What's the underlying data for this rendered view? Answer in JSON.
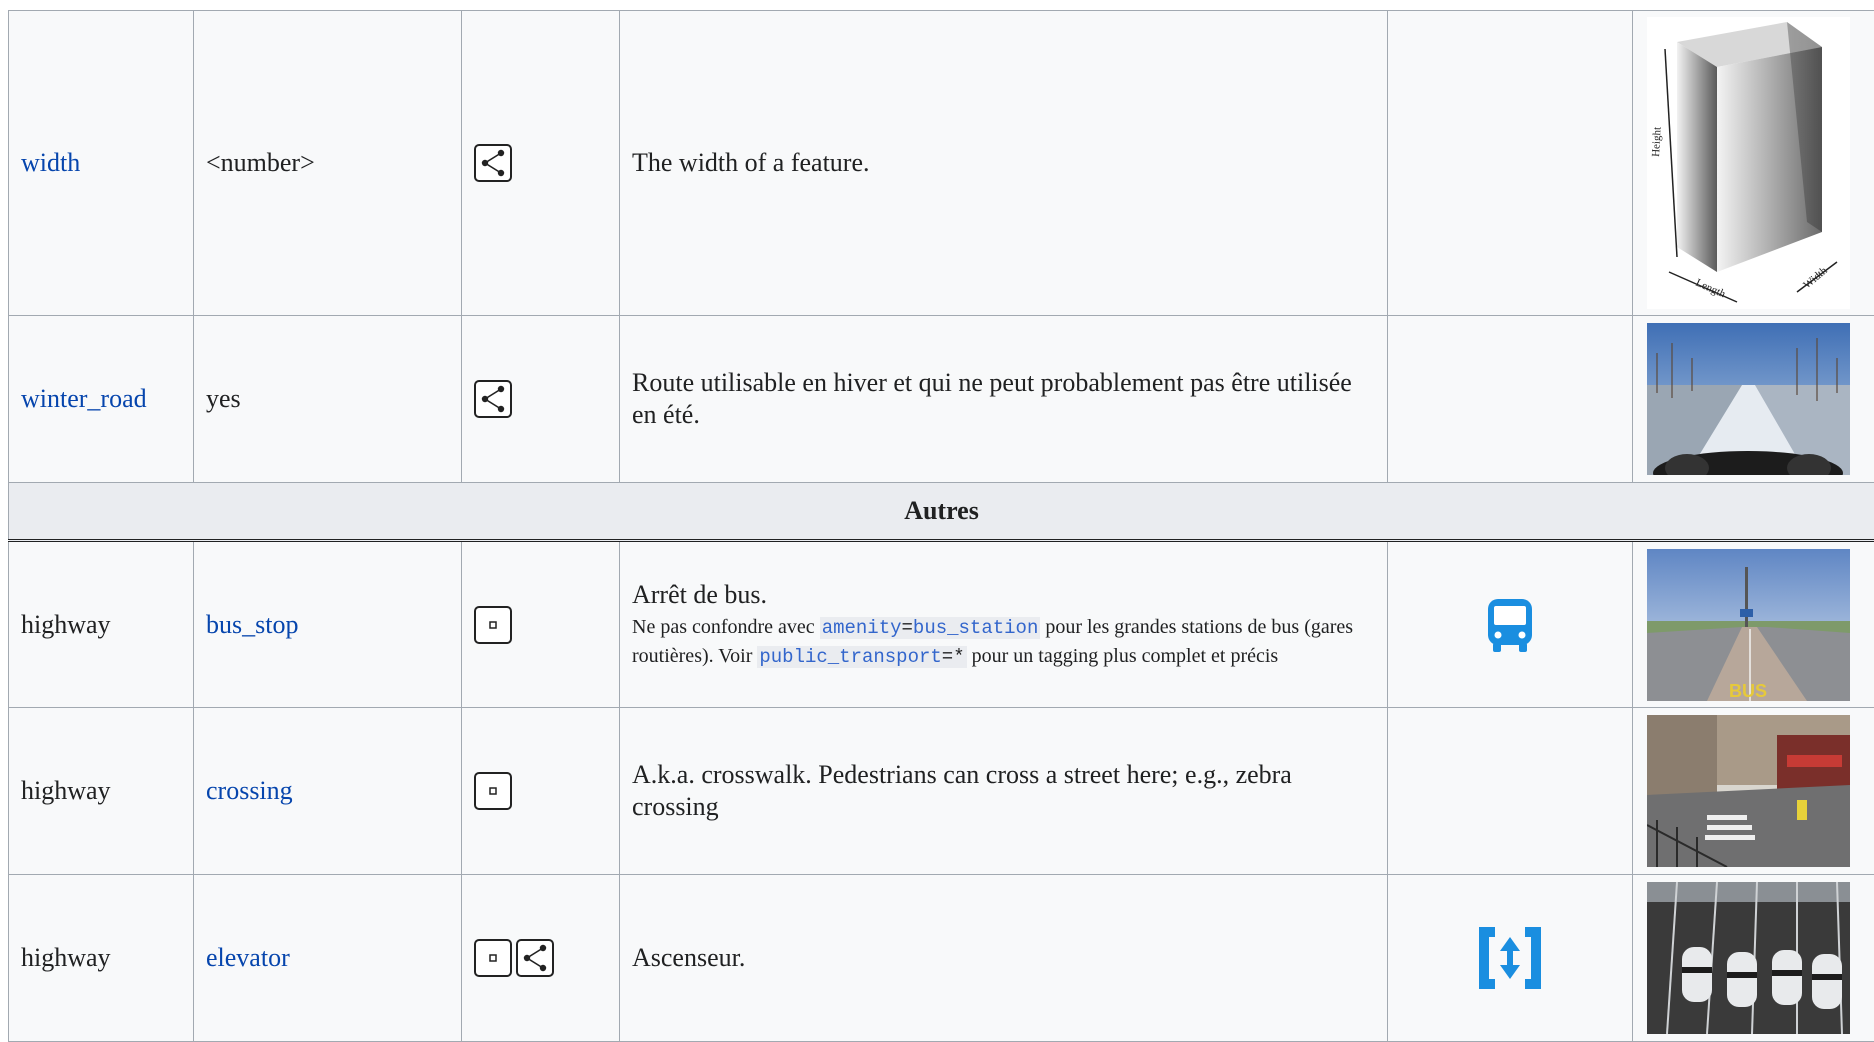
{
  "rows_top": [
    {
      "key": "width",
      "value": "<number>",
      "desc": "The width of a feature."
    },
    {
      "key": "winter_road",
      "value": "yes",
      "desc": "Route utilisable en hiver et qui ne peut probablement pas être utilisée en été."
    }
  ],
  "section": {
    "title": "Autres"
  },
  "rows_bottom": [
    {
      "key": "highway",
      "value": "bus_stop",
      "desc": "Arrêt de bus.",
      "note": {
        "prefix": "Ne pas confondre avec ",
        "tag1_key": "amenity",
        "tag1_eq": "=",
        "tag1_val": "bus_station",
        "middle": " pour les grandes stations de bus (gares routières). Voir ",
        "tag2_key": "public_transport",
        "tag2_eq": "=*",
        "suffix": " pour un tagging plus complet et précis"
      }
    },
    {
      "key": "highway",
      "value": "crossing",
      "desc": "A.k.a. crosswalk. Pedestrians can cross a street here; e.g., zebra crossing"
    },
    {
      "key": "highway",
      "value": "elevator",
      "desc": "Ascenseur."
    }
  ],
  "image_labels": {
    "height": "Height",
    "length": "Length",
    "width": "Width"
  },
  "icons": {
    "way_icon": "way-icon",
    "node_icon": "node-icon",
    "bus_icon": "bus-icon",
    "elevator_icon": "elevator-icon"
  },
  "colors": {
    "link": "#0645ad",
    "tag_code": "#3366cc",
    "icon_blue": "#1a8ee0",
    "header_bg": "#eaecf0",
    "cell_bg": "#f8f9fa"
  }
}
